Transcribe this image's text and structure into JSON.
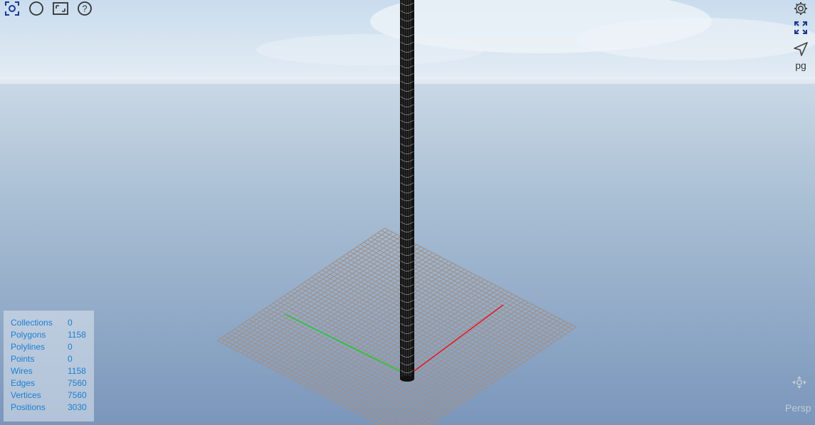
{
  "toolbar_left": [
    {
      "name": "zoom-fit-icon"
    },
    {
      "name": "circle-icon"
    },
    {
      "name": "frame-icon"
    },
    {
      "name": "help-icon"
    }
  ],
  "toolbar_right": [
    {
      "name": "settings-gear-icon"
    },
    {
      "name": "fullscreen-icon"
    },
    {
      "name": "navigate-arrow-icon"
    }
  ],
  "projection_label": "pg",
  "stats": [
    {
      "label": "Collections",
      "value": "0"
    },
    {
      "label": "Polygons",
      "value": "1158"
    },
    {
      "label": "Polylines",
      "value": "0"
    },
    {
      "label": "Points",
      "value": "0"
    },
    {
      "label": "Wires",
      "value": "1158"
    },
    {
      "label": "Edges",
      "value": "7560"
    },
    {
      "label": "Vertices",
      "value": "7560"
    },
    {
      "label": "Positions",
      "value": "3030"
    }
  ],
  "camera_label": "Persp",
  "colors": {
    "accent": "#1a3a8f",
    "stat_text": "#1a7fd1",
    "grid": "#a0928c",
    "axis_x": "#e8161b",
    "axis_y": "#22c922",
    "mesh": "#111111"
  }
}
